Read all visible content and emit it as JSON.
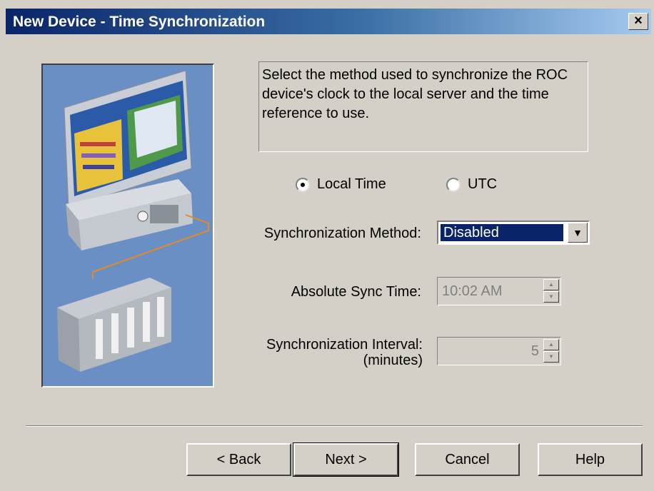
{
  "window": {
    "title": "New Device - Time Synchronization",
    "close_label": "×"
  },
  "description": "Select the method used to synchronize the ROC device's clock to the local server and the time reference to use.",
  "time_reference": {
    "options": [
      {
        "label": "Local Time",
        "selected": true
      },
      {
        "label": "UTC",
        "selected": false
      }
    ]
  },
  "sync_method": {
    "label": "Synchronization Method:",
    "value": "Disabled",
    "arrow": "▼"
  },
  "absolute_sync_time": {
    "label": "Absolute Sync Time:",
    "value": "10:02 AM",
    "enabled": false
  },
  "sync_interval": {
    "label_line1": "Synchronization Interval:",
    "label_line2": "(minutes)",
    "value": "5",
    "enabled": false
  },
  "buttons": {
    "back": "< Back",
    "next": "Next >",
    "cancel": "Cancel",
    "help": "Help"
  },
  "colors": {
    "title_start": "#0a246a",
    "title_end": "#a6caf0",
    "selection": "#0a246a",
    "panel": "#6a8fc4"
  }
}
